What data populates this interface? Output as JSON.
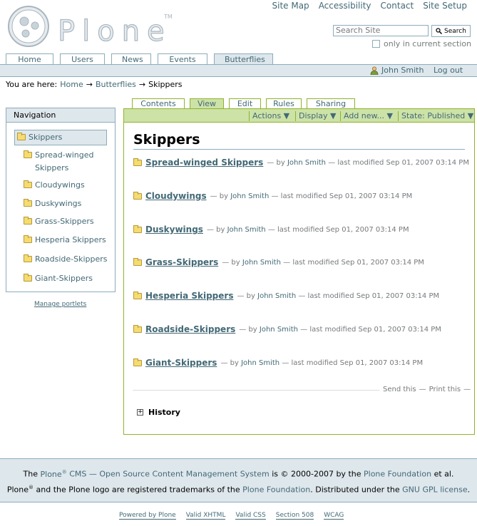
{
  "logo": {
    "text": "Plone",
    "tm": "TM"
  },
  "site_actions": [
    "Site Map",
    "Accessibility",
    "Contact",
    "Site Setup"
  ],
  "search": {
    "placeholder": "Search Site",
    "button": "Search",
    "only_section": "only in current section"
  },
  "portal_tabs": [
    {
      "label": "Home",
      "selected": false
    },
    {
      "label": "Users",
      "selected": false
    },
    {
      "label": "News",
      "selected": false
    },
    {
      "label": "Events",
      "selected": false
    },
    {
      "label": "Butterflies",
      "selected": true
    }
  ],
  "personal_bar": {
    "user": "John Smith",
    "logout": "Log out"
  },
  "breadcrumbs": {
    "prefix": "You are here:",
    "items": [
      "Home",
      "Butterflies",
      "Skippers"
    ],
    "separator": "→"
  },
  "navigation": {
    "title": "Navigation",
    "current": "Skippers",
    "items": [
      "Spread-winged Skippers",
      "Cloudywings",
      "Duskywings",
      "Grass-Skippers",
      "Hesperia Skippers",
      "Roadside-Skippers",
      "Giant-Skippers"
    ],
    "manage": "Manage portlets"
  },
  "content_tabs": [
    "Contents",
    "View",
    "Edit",
    "Rules",
    "Sharing"
  ],
  "content_actions": [
    "Actions ▼",
    "Display ▼",
    "Add new... ▼",
    "State: Published ▼"
  ],
  "page_title": "Skippers",
  "listing": {
    "by": "— by",
    "modified": "— last modified Sep 01, 2007 03:14 PM",
    "author": "John Smith",
    "items": [
      "Spread-winged Skippers",
      "Cloudywings",
      "Duskywings",
      "Grass-Skippers",
      "Hesperia Skippers",
      "Roadside-Skippers",
      "Giant-Skippers"
    ]
  },
  "document_actions": {
    "send": "Send this",
    "print": "Print this",
    "sep": "—"
  },
  "history": "History",
  "footer": {
    "line1_a": "The",
    "plone": "Plone",
    "cms": "CMS — Open Source Content Management System",
    "line1_b": "is © 2000-2007 by the",
    "foundation": "Plone Foundation",
    "line1_c": "et al.",
    "line2_a": "and the Plone logo are registered trademarks of the",
    "line2_b": ". Distributed under the",
    "gpl": "GNU GPL license",
    "line2_c": "."
  },
  "colophon": [
    "Powered by Plone",
    "Valid XHTML",
    "Valid CSS",
    "Section 508",
    "WCAG"
  ]
}
